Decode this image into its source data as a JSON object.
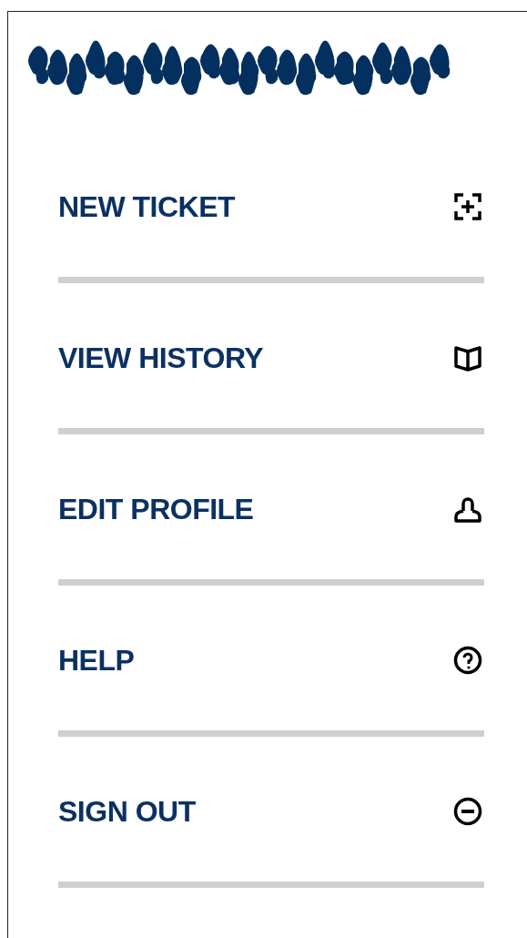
{
  "menu": {
    "items": [
      {
        "label": "NEW TICKET",
        "kind": "add"
      },
      {
        "label": "VIEW HISTORY",
        "kind": "book"
      },
      {
        "label": "EDIT PROFILE",
        "kind": "person"
      },
      {
        "label": "HELP",
        "kind": "help"
      },
      {
        "label": "SIGN OUT",
        "kind": "signout"
      }
    ]
  }
}
